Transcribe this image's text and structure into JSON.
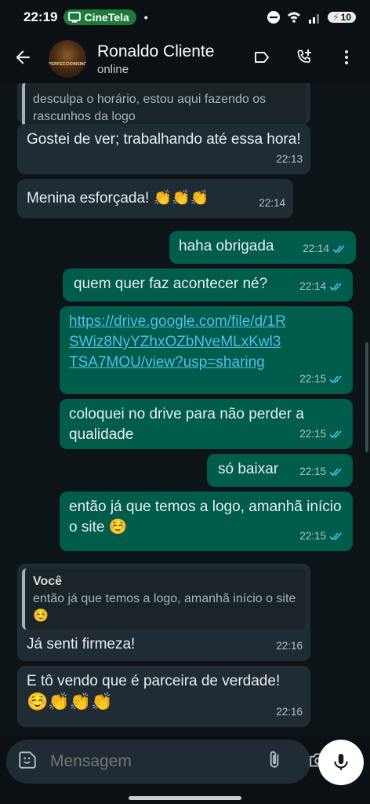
{
  "status": {
    "time": "22:19",
    "cast_label": "CineTela",
    "dot": "•",
    "battery": "10"
  },
  "header": {
    "contact_name": "Ronaldo Cliente",
    "contact_status": "online",
    "avatar_text": "PERFECCIONISMO"
  },
  "messages": [
    {
      "dir": "in",
      "quote_text": "desculpa o horário, estou aqui fazendo os rascunhos da logo"
    },
    {
      "dir": "in",
      "text": "Gostei de ver; trabalhando até essa hora!",
      "time": "22:13"
    },
    {
      "dir": "in",
      "text": "Menina esforçada! 👏👏👏",
      "time": "22:14"
    },
    {
      "dir": "out",
      "text": "haha obrigada",
      "time": "22:14"
    },
    {
      "dir": "out",
      "text": "quem quer faz acontecer né?",
      "time": "22:14"
    },
    {
      "dir": "out",
      "link": "https://drive.google.com/file/d/1RSWiz8NyYZhxOZbNveMLxKwl3TSA7MOU/view?usp=sharing",
      "time": "22:15"
    },
    {
      "dir": "out",
      "text": "coloquei no drive para não perder a qualidade",
      "time": "22:15"
    },
    {
      "dir": "out",
      "text": "só baixar",
      "time": "22:15"
    },
    {
      "dir": "out",
      "text": "então já que temos a logo, amanhã início o site ☺️",
      "time": "22:15"
    },
    {
      "dir": "in",
      "quote_author": "Você",
      "quote_text": "então já que temos a logo, amanhã início o site ☺️",
      "text": "Já senti firmeza!",
      "time": "22:16"
    },
    {
      "dir": "in",
      "text": "E tô vendo que é parceira de verdade!",
      "emoji_line": "☺️👏👏👏",
      "time": "22:16"
    }
  ],
  "input": {
    "placeholder": "Mensagem"
  },
  "colors": {
    "incoming": "#202c33",
    "outgoing": "#005c4b",
    "link": "#53bdeb",
    "read_ticks": "#53bdeb"
  },
  "icons": [
    "back-arrow-icon",
    "label-icon",
    "add-call-icon",
    "more-vert-icon",
    "sticker-icon",
    "attach-icon",
    "camera-icon",
    "mic-icon",
    "double-check-icon"
  ]
}
